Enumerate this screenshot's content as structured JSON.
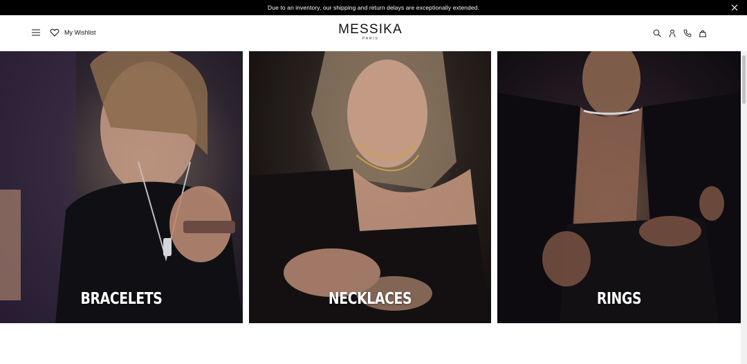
{
  "announcement": {
    "text": "Due to an inventory, our shipping and return delays are exceptionally extended.",
    "close_icon": "close-icon"
  },
  "header": {
    "menu_icon": "hamburger-icon",
    "wishlist_icon": "heart-icon",
    "wishlist_label": "My Wishlist",
    "logo": {
      "brand": "MESSIKA",
      "city": "PARIS"
    },
    "right_icons": [
      "search-icon",
      "account-icon",
      "phone-icon",
      "bag-icon"
    ]
  },
  "categories": [
    {
      "label": "BRACELETS"
    },
    {
      "label": "NECKLACES"
    },
    {
      "label": "RINGS"
    }
  ],
  "colors": {
    "announcement_bg": "#000000",
    "page_bg": "#ffffff",
    "tile_label": "#ffffff"
  }
}
